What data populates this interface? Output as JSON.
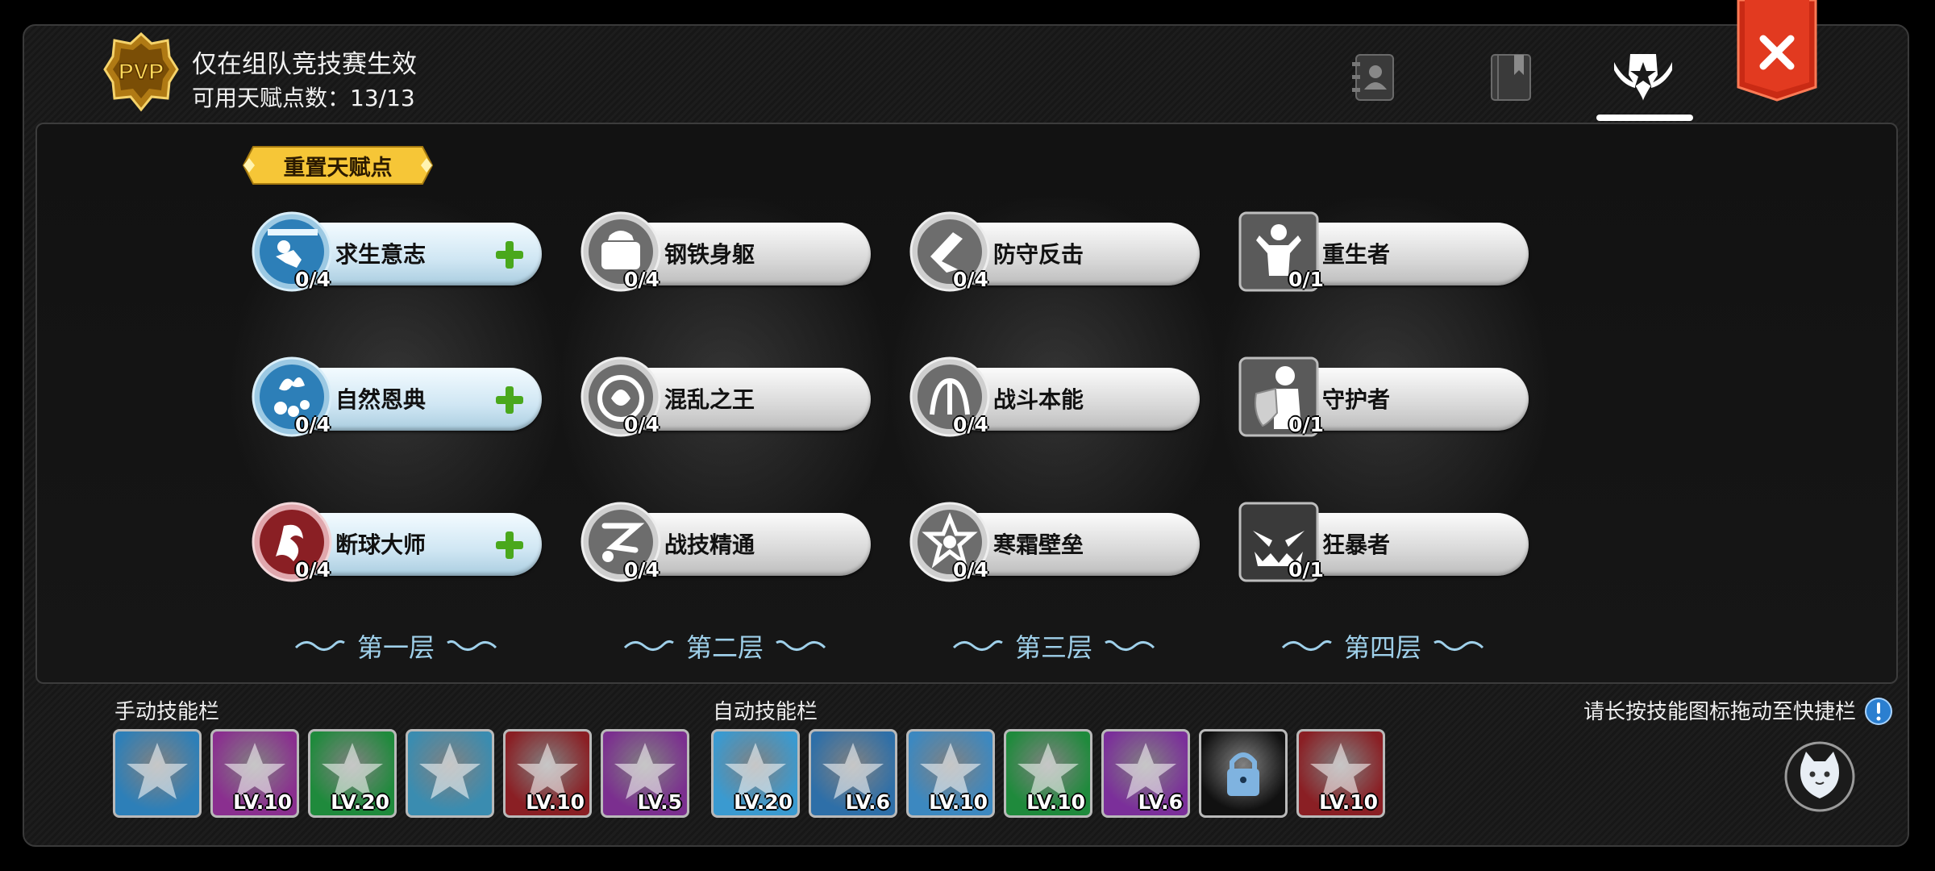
{
  "header": {
    "badge_text": "PVP",
    "line1": "仅在组队竞技赛生效",
    "line2": "可用天赋点数：13/13"
  },
  "tabs": [
    {
      "icon": "contacts-book-icon"
    },
    {
      "icon": "bookmark-book-icon"
    },
    {
      "icon": "pvp-emblem-icon",
      "active": true
    }
  ],
  "reset_button": "重置天赋点",
  "tiers": [
    {
      "label": "第一层",
      "talents": [
        {
          "name": "求生意志",
          "count": "0/4",
          "can_add": true
        },
        {
          "name": "自然恩典",
          "count": "0/4",
          "can_add": true
        },
        {
          "name": "断球大师",
          "count": "0/4",
          "can_add": true
        }
      ]
    },
    {
      "label": "第二层",
      "talents": [
        {
          "name": "钢铁身躯",
          "count": "0/4",
          "can_add": false
        },
        {
          "name": "混乱之王",
          "count": "0/4",
          "can_add": false
        },
        {
          "name": "战技精通",
          "count": "0/4",
          "can_add": false
        }
      ]
    },
    {
      "label": "第三层",
      "talents": [
        {
          "name": "防守反击",
          "count": "0/4",
          "can_add": false
        },
        {
          "name": "战斗本能",
          "count": "0/4",
          "can_add": false
        },
        {
          "name": "寒霜壁垒",
          "count": "0/4",
          "can_add": false
        }
      ]
    },
    {
      "label": "第四层",
      "talents": [
        {
          "name": "重生者",
          "count": "0/1",
          "can_add": false
        },
        {
          "name": "守护者",
          "count": "0/1",
          "can_add": false
        },
        {
          "name": "狂暴者",
          "count": "0/1",
          "can_add": false
        }
      ]
    }
  ],
  "manual_bar": {
    "label": "手动技能栏",
    "skills": [
      {
        "level": "",
        "color": "#2d7fb8"
      },
      {
        "level": "LV.10",
        "color": "#8a2f8f"
      },
      {
        "level": "LV.20",
        "color": "#1f8a3c"
      },
      {
        "level": "",
        "color": "#3a8cb0"
      },
      {
        "level": "LV.10",
        "color": "#8a1f24"
      },
      {
        "level": "LV.5",
        "color": "#7b2f8f"
      }
    ]
  },
  "auto_bar": {
    "label": "自动技能栏",
    "skills": [
      {
        "level": "LV.20",
        "color": "#3a9ad0"
      },
      {
        "level": "LV.6",
        "color": "#2e6fa8"
      },
      {
        "level": "LV.10",
        "color": "#3c88c0"
      },
      {
        "level": "LV.10",
        "color": "#1f8a3c"
      },
      {
        "level": "LV.6",
        "color": "#7b2f9a"
      },
      {
        "level": "",
        "color": "#111111",
        "locked": true
      },
      {
        "level": "LV.10",
        "color": "#8a1f24"
      }
    ]
  },
  "hint": "请长按技能图标拖动至快捷栏",
  "colors": {
    "accent_gold": "#f6c637",
    "close_red": "#d8321c",
    "tier_text": "#9fd0ea"
  }
}
